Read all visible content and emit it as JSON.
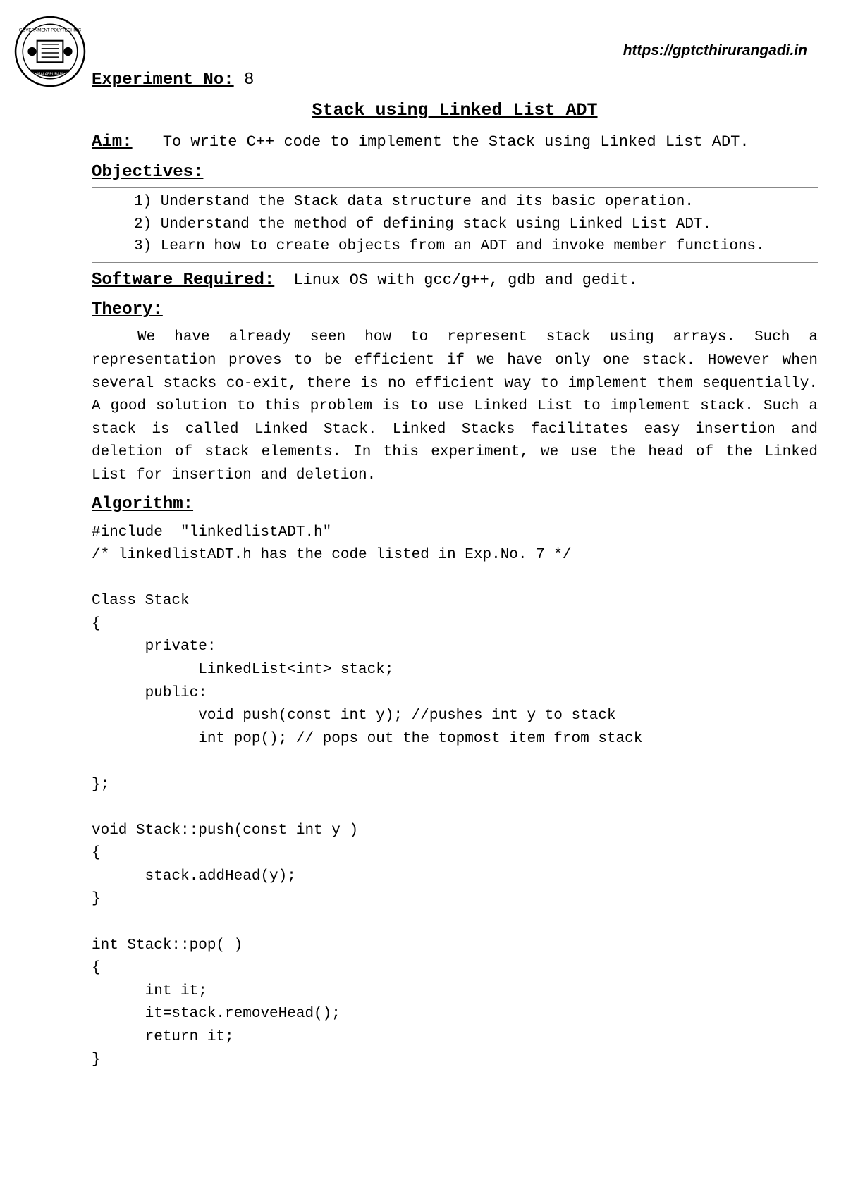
{
  "url": "https://gptcthirurangadi.in",
  "experiment": {
    "label": "Experiment No:",
    "number": "8"
  },
  "title": "Stack using Linked List ADT",
  "aim": {
    "label": "Aim:",
    "text": "To write C++ code to implement the Stack using Linked List ADT."
  },
  "objectives": {
    "label": "Objectives:",
    "items": [
      "1) Understand the Stack data structure and its basic operation.",
      "2) Understand the method of defining stack using Linked List ADT.",
      "3) Learn how to create objects from an ADT and invoke member functions."
    ]
  },
  "software": {
    "label": "Software Required:",
    "text": "Linux OS with gcc/g++, gdb and gedit."
  },
  "theory": {
    "label": "Theory:",
    "body": "We have already seen how to represent stack using arrays. Such a representation proves to be efficient if we have only one stack. However when several stacks co-exit, there is no efficient way to implement them sequentially. A good solution to this problem is to use Linked List to implement stack. Such a stack is called Linked Stack. Linked Stacks facilitates easy insertion and deletion of stack elements. In this experiment,  we use the head of the Linked List for insertion and deletion."
  },
  "algorithm": {
    "label": "Algorithm:",
    "code": "#include  \"linkedlistADT.h\"\n/* linkedlistADT.h has the code listed in Exp.No. 7 */\n\nClass Stack\n{\n      private:\n            LinkedList<int> stack;\n      public:\n            void push(const int y); //pushes int y to stack\n            int pop(); // pops out the topmost item from stack\n\n};\n\nvoid Stack::push(const int y )\n{\n      stack.addHead(y);\n}\n\nint Stack::pop( )\n{\n      int it;\n      it=stack.removeHead();\n      return it;\n}"
  }
}
